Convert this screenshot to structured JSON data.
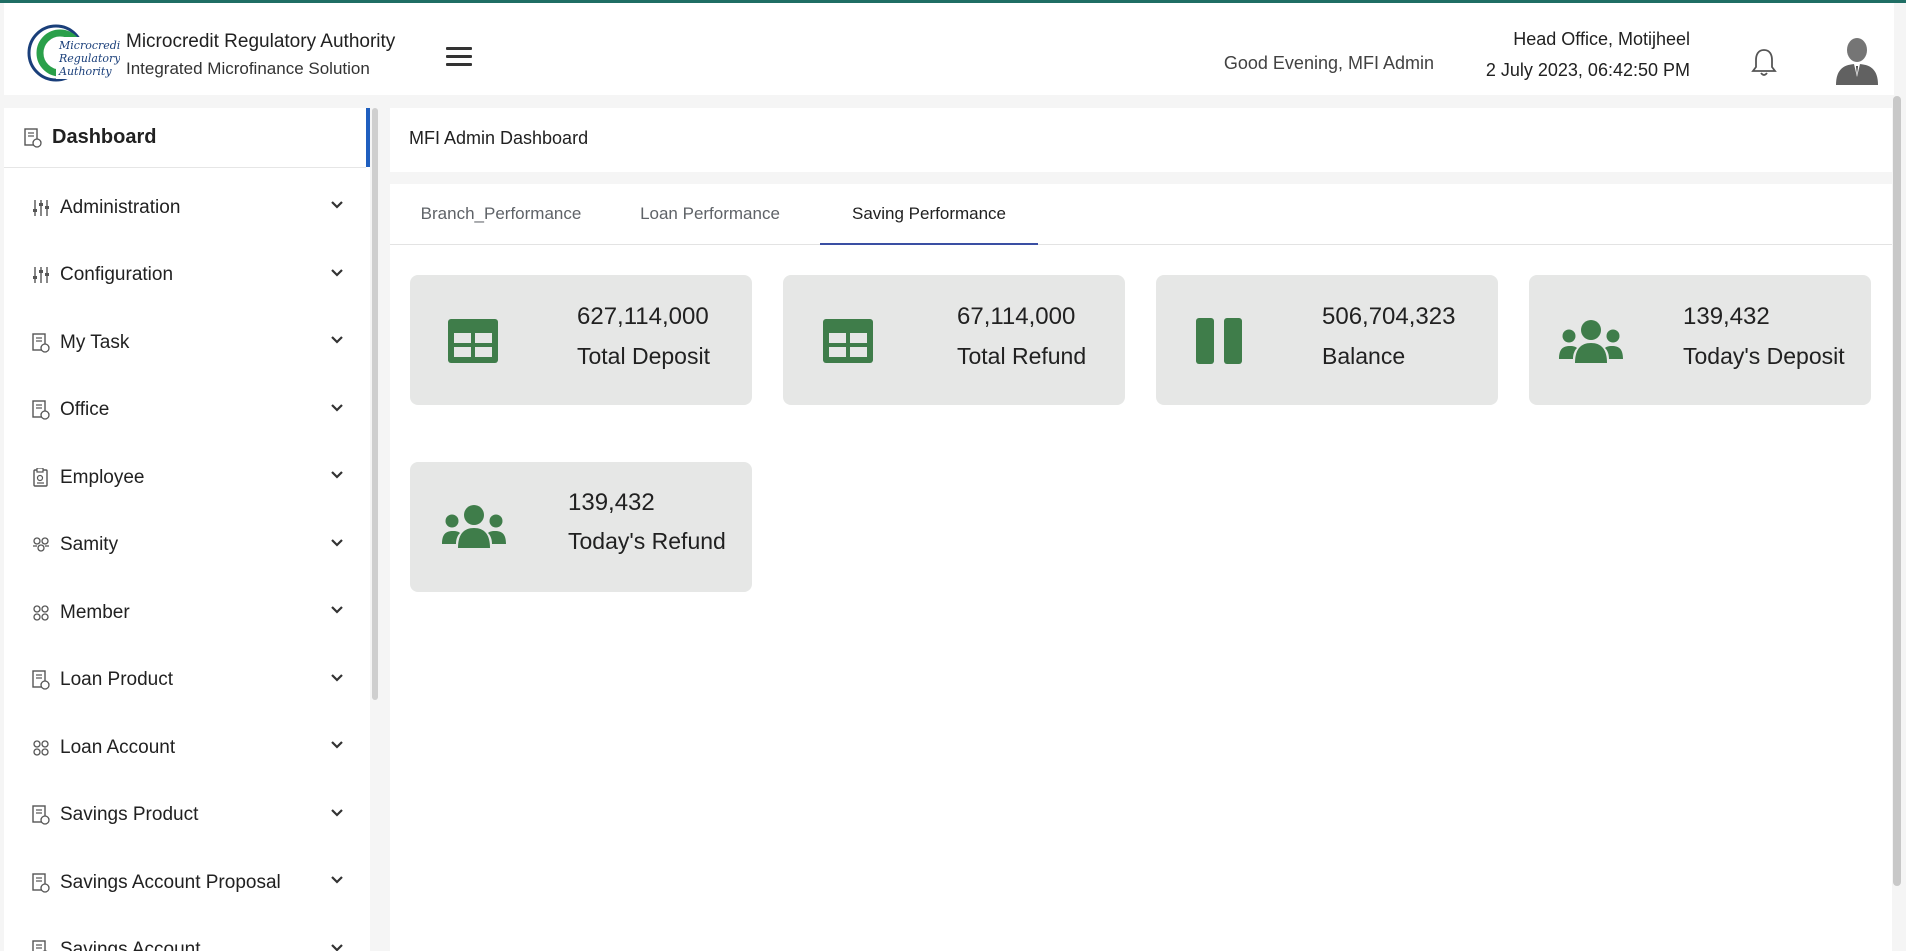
{
  "header": {
    "logo_text": "Microcredit Regulatory Authority",
    "org_name": "Microcredit Regulatory Authority",
    "org_sub": "Integrated Microfinance Solution",
    "greeting": "Good Evening, MFI Admin",
    "office": "Head Office, Motijheel",
    "datetime": "2 July 2023, 06:42:50 PM"
  },
  "sidebar": {
    "dashboard_label": "Dashboard",
    "items": [
      {
        "label": "Administration",
        "icon": "sliders-icon"
      },
      {
        "label": "Configuration",
        "icon": "sliders-icon"
      },
      {
        "label": "My Task",
        "icon": "document-icon"
      },
      {
        "label": "Office",
        "icon": "document-icon"
      },
      {
        "label": "Employee",
        "icon": "id-card-icon"
      },
      {
        "label": "Samity",
        "icon": "group-icon"
      },
      {
        "label": "Member",
        "icon": "group-icon"
      },
      {
        "label": "Loan Product",
        "icon": "document-icon"
      },
      {
        "label": "Loan Account",
        "icon": "group-icon"
      },
      {
        "label": "Savings Product",
        "icon": "document-icon"
      },
      {
        "label": "Savings Account Proposal",
        "icon": "document-icon"
      },
      {
        "label": "Savings Account",
        "icon": "document-icon"
      }
    ]
  },
  "main": {
    "title": "MFI Admin Dashboard",
    "tabs": [
      {
        "label": "Branch_Performance",
        "active": false
      },
      {
        "label": "Loan Performance",
        "active": false
      },
      {
        "label": "Saving Performance",
        "active": true
      }
    ],
    "cards": [
      {
        "value": "627,114,000",
        "caption": "Total Deposit",
        "icon": "table-icon"
      },
      {
        "value": "67,114,000",
        "caption": "Total Refund",
        "icon": "table-icon"
      },
      {
        "value": "506,704,323",
        "caption": "Balance",
        "icon": "pause-icon"
      },
      {
        "value": "139,432",
        "caption": "Today's Deposit",
        "icon": "users-icon"
      },
      {
        "value": "139,432",
        "caption": "Today's Refund",
        "icon": "users-icon"
      }
    ]
  },
  "colors": {
    "accent_green": "#3f7d4a",
    "active_tab_underline": "#3a4fa3",
    "active_sidebar_bar": "#1f5fbf",
    "top_line": "#1f6e64",
    "card_bg": "#e6e7e6"
  }
}
